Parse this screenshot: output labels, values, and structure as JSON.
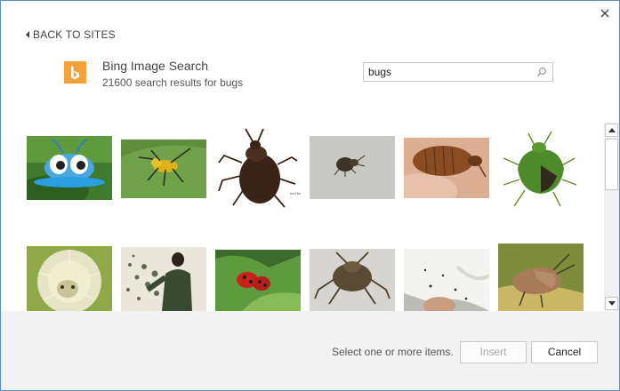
{
  "dialog": {
    "back_label": "BACK TO SITES",
    "close_icon": "close-icon"
  },
  "service": {
    "title": "Bing Image Search",
    "results": "21600 search results for bugs",
    "logo_color": "#f4a13b"
  },
  "search": {
    "value": "bugs",
    "icon": "search-icon"
  },
  "results": [
    {
      "subject": "cartoon-bug",
      "colors": [
        "#3c6f2a",
        "#46a4e0"
      ]
    },
    {
      "subject": "yellow-beetle-on-leaf",
      "colors": [
        "#5f8f3c",
        "#d8b21e"
      ]
    },
    {
      "subject": "bed-bug",
      "colors": [
        "#ffffff",
        "#3b2418"
      ]
    },
    {
      "subject": "small-beetle-gray",
      "colors": [
        "#c7c7c4",
        "#3d3428"
      ]
    },
    {
      "subject": "bed-bug-closeup",
      "colors": [
        "#d9a98f",
        "#8a4d24"
      ]
    },
    {
      "subject": "green-shield-bug",
      "colors": [
        "#ffffff",
        "#4c7f2a"
      ]
    },
    {
      "subject": "fuzzy-caterpillar",
      "colors": [
        "#9fb548",
        "#e3e2c4"
      ]
    },
    {
      "subject": "man-dispersing",
      "colors": [
        "#e8e4d9",
        "#3b4a36"
      ]
    },
    {
      "subject": "ladybug",
      "colors": [
        "#3c6c2c",
        "#c8231b"
      ]
    },
    {
      "subject": "stink-bug-gray",
      "colors": [
        "#d7d6d2",
        "#5a4b34"
      ]
    },
    {
      "subject": "bugs-on-fabric",
      "colors": [
        "#bdbdb5",
        "#f4f4f2"
      ]
    },
    {
      "subject": "stink-bug-green",
      "colors": [
        "#7f8d3e",
        "#a67a56"
      ]
    }
  ],
  "footer": {
    "hint": "Select one or more items.",
    "insert_label": "Insert",
    "cancel_label": "Cancel",
    "insert_enabled": false
  }
}
